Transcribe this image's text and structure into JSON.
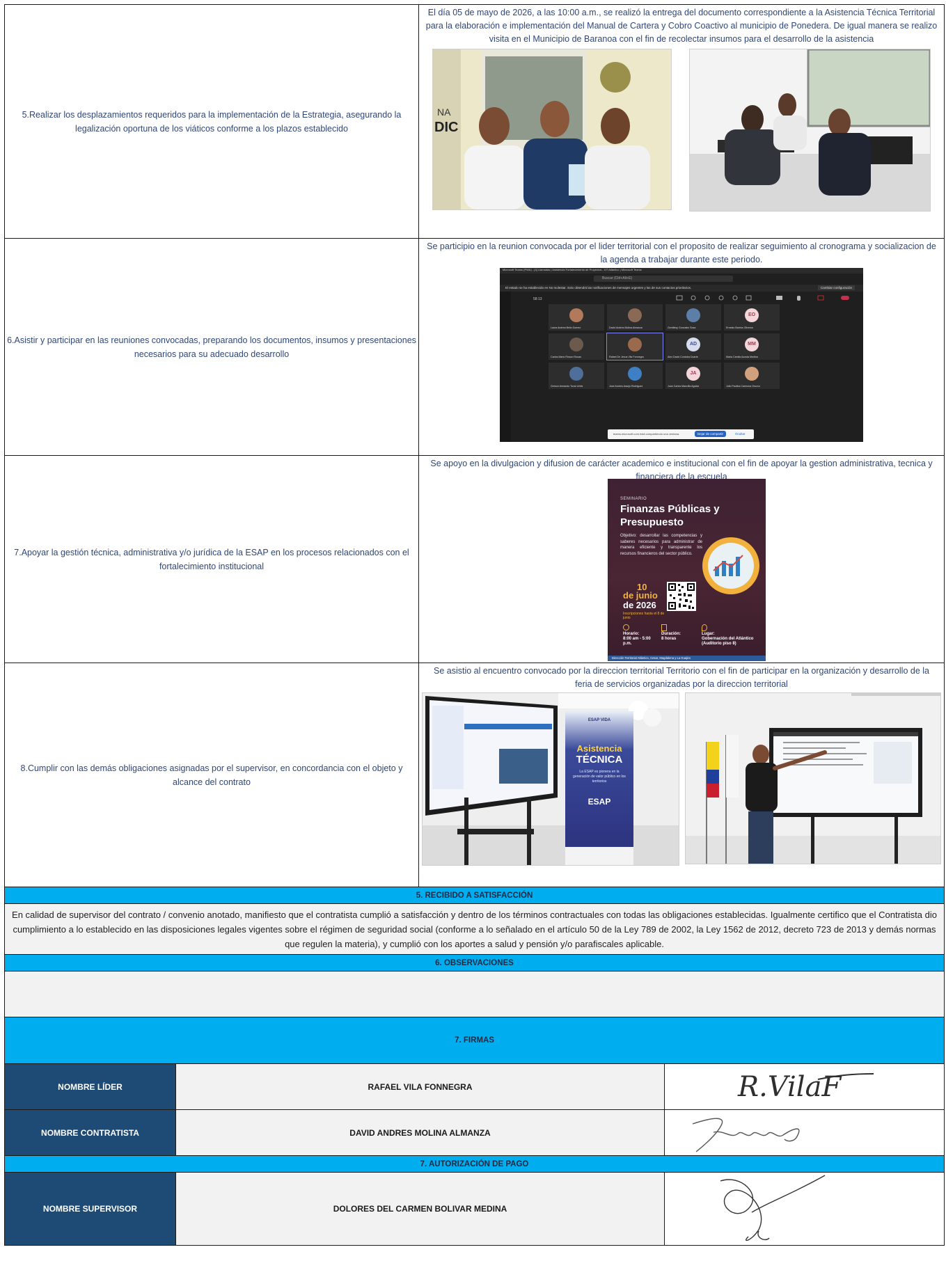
{
  "rows": [
    {
      "obligation": "5.Realizar los desplazamientos requeridos para la implementación de la Estrategia, asegurando la legalización oportuna de los viáticos conforme a los plazos establecido",
      "evidence": "El día 05 de mayo de 2026, a las 10:00 a.m., se realizó la entrega del documento correspondiente a la Asistencia Técnica Territorial para la elaboración e implementación del Manual de Cartera y Cobro Coactivo al municipio de Ponedera. De igual manera se realizo visita en el Municipio de Baranoa con el fin de recolectar insumos para el desarrollo de la asistencia"
    },
    {
      "obligation": "6.Asistir y participar en las reuniones convocadas, preparando los documentos, insumos y presentaciones necesarios para su adecuado desarrollo",
      "evidence": "Se participio en la reunion convocada por el lider territorial con el proposito de realizar seguimiento al cronograma y socializacion de la agenda a trabajar durante este periodo."
    },
    {
      "obligation": "7.Apoyar la gestión técnica, administrativa y/o jurídica de la ESAP en los procesos relacionados con el fortalecimiento institucional",
      "evidence": "Se apoyo en la divulgacion y difusion de carácter academico e institucional con el fin de apoyar la gestion administrativa, tecnica y financiera de la escuela"
    },
    {
      "obligation": "8.Cumplir con las demás obligaciones asignadas por el supervisor, en concordancia con el objeto y alcance del contrato",
      "evidence": "Se asistio al encuentro convocado por la direccion territorial Territorio con el fin de participar en la organización y desarrollo de la feria de servicios organizadas por la direccion territorial"
    }
  ],
  "meeting": {
    "bar_title": "Microsoft Teams (PWA) - [4] Llamadas | Asistencia Fortalecimiento de Proyectos - DT Atlántico | Microsoft Teams",
    "search": "Buscar (Ctrl+Alt+E)",
    "notice": "El estado se ha establecido en No molestar. Solo obtendrá las notificaciones de mensajes urgentes y las de sus contactos prioritarios.",
    "notice_button": "Cambiar configuración",
    "timer": "58:13",
    "share_text": "teams.microsoft.com está compartiendo una ventana.",
    "share_stop": "Dejar de compartir",
    "share_hide": "Ocultar",
    "participants": [
      {
        "name": "Laura Andrea Bello Gomez",
        "initials": ""
      },
      {
        "name": "David Andres Molina Almanza",
        "initials": ""
      },
      {
        "name": "Gentilesy Gonzalez Sosa",
        "initials": ""
      },
      {
        "name": "Ernesto Barrios Oliveros",
        "initials": "EO"
      },
      {
        "name": "Carlos Mario Rincon Rosas",
        "initials": ""
      },
      {
        "name": "Rafael De Jesus Vila Fonnegra",
        "initials": ""
      },
      {
        "name": "Alex David Cordoba Duarte",
        "initials": "AD"
      },
      {
        "name": "Maria Camila Acosta Medina",
        "initials": "MM"
      },
      {
        "name": "Gerson Armando Tovar Urbis",
        "initials": ""
      },
      {
        "name": "Jose Andres Araujo Rodriguez",
        "initials": ""
      },
      {
        "name": "Juan Carlos Mancilla Aguilar",
        "initials": "JA"
      },
      {
        "name": "Julio Paulina Carmona Orozco",
        "initials": ""
      }
    ]
  },
  "flyer": {
    "kicker": "SEMINARIO",
    "title": "Finanzas Públicas y Presupuesto",
    "objective": "Objetivo: desarrollar las competencias y saberes necesarios para administrar de manera eficiente y transparente los recursos financieros del sector público.",
    "date_day": "10",
    "date_month": "de junio",
    "date_year": "de 2026",
    "date_note": "Inscripciones hasta el 8 de junio",
    "horario_label": "Horario:",
    "horario": "8:00 am - 5:00 p.m.",
    "duracion_label": "Duración:",
    "duracion": "8 horas",
    "lugar_label": "Lugar:",
    "lugar": "Gobernación del Atlántico (Auditorio piso 8)",
    "footer": "Dirección Territorial Atlántico, Cesar, Magdalena y La Guajira"
  },
  "banner": {
    "top": "ESAP VIDA",
    "line1": "Asistencia",
    "line2": "TÉCNICA",
    "sub": "La ESAP es pionera en la generación de valor público en los territorios",
    "logo": "ESAP"
  },
  "sections": {
    "recibido": "5. RECIBIDO A SATISFACCIÓN",
    "cert_text": "En calidad de supervisor del contrato / convenio anotado, manifiesto que el contratista cumplió a satisfacción y dentro de los términos contractuales con todas las obligaciones establecidas. Igualmente certifico que el Contratista dio cumplimiento a lo establecido en las disposiciones legales vigentes sobre el régimen de seguridad social (conforme a lo señalado en el artículo 50 de la Ley 789 de 2002, la Ley 1562 de 2012, decreto 723 de 2013 y demás normas que regulen la materia), y cumplió con los aportes a salud y pensión y/o parafiscales aplicable.",
    "observaciones": "6. OBSERVACIONES",
    "observaciones_text": "",
    "firmas": "7. FIRMAS",
    "autorizacion": "7. AUTORIZACIÓN DE PAGO"
  },
  "signatures": [
    {
      "role": "NOMBRE LÍDER",
      "name": "RAFAEL VILA FONNEGRA",
      "signature_text": "R.VilaF"
    },
    {
      "role": "NOMBRE CONTRATISTA",
      "name": "DAVID ANDRES MOLINA ALMANZA",
      "signature_text": ""
    },
    {
      "role": "NOMBRE SUPERVISOR",
      "name": "DOLORES DEL CARMEN BOLIVAR MEDINA",
      "signature_text": ""
    }
  ],
  "colors": {
    "section_blue": "#00adef",
    "navy": "#1e4b75",
    "text_blue": "#2f4778",
    "light_gray": "#f2f2f2"
  }
}
